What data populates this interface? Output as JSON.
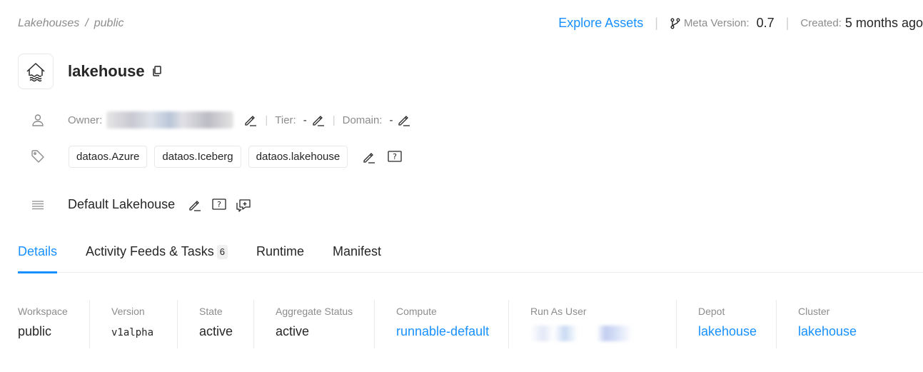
{
  "breadcrumb": {
    "items": [
      "Lakehouses",
      "public"
    ],
    "separator": "/"
  },
  "header": {
    "explore_label": "Explore Assets",
    "meta_version_label": "Meta Version:",
    "meta_version_value": "0.7",
    "created_label": "Created:",
    "created_value": "5 months ago"
  },
  "entity": {
    "name": "lakehouse",
    "logo_icon": "lakehouse-icon"
  },
  "info": {
    "owner_label": "Owner:",
    "tier_label": "Tier:",
    "tier_value": "-",
    "domain_label": "Domain:",
    "domain_value": "-"
  },
  "tags": [
    "dataos.Azure",
    "dataos.Iceberg",
    "dataos.lakehouse"
  ],
  "description": "Default Lakehouse",
  "tabs": [
    {
      "label": "Details",
      "active": true
    },
    {
      "label": "Activity Feeds & Tasks",
      "count": "6"
    },
    {
      "label": "Runtime"
    },
    {
      "label": "Manifest"
    }
  ],
  "details": {
    "workspace": {
      "label": "Workspace",
      "value": "public"
    },
    "version": {
      "label": "Version",
      "value": "v1alpha"
    },
    "state": {
      "label": "State",
      "value": "active"
    },
    "aggregate_status": {
      "label": "Aggregate Status",
      "value": "active"
    },
    "compute": {
      "label": "Compute",
      "value": "runnable-default"
    },
    "run_as_user": {
      "label": "Run As User"
    },
    "depot": {
      "label": "Depot",
      "value": "lakehouse"
    },
    "cluster": {
      "label": "Cluster",
      "value": "lakehouse"
    }
  },
  "colors": {
    "accent": "#1890ff",
    "muted": "#8c8c8c",
    "text": "#262626"
  }
}
